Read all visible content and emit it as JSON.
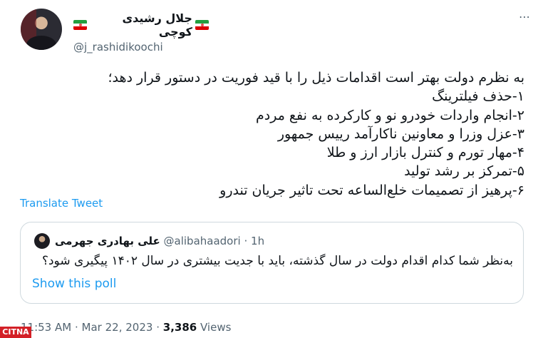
{
  "author": {
    "display_name": "جلال رشیدی کوچی",
    "handle": "@j_rashidikoochi"
  },
  "more_icon": "⋯",
  "tweet_lines": [
    "به نظرم دولت بهتر است اقدامات ذیل را با قید فوریت در دستور قرار دهد؛",
    "۱-حذف فیلترینگ",
    "۲-انجام واردات خودرو نو و کارکرده به نفع مردم",
    "۳-عزل وزرا و معاونین ناکارآمد رییس جمهور",
    "۴-مهار تورم و کنترل بازار ارز و طلا",
    "۵-تمرکز بر رشد تولید",
    "۶-پرهیز از تصمیمات خلع‌الساعه تحت تاثیر جریان تندرو"
  ],
  "translate_label": "Translate Tweet",
  "quote": {
    "name": "علی بهادری جهرمی",
    "handle": "@alibahaadori",
    "separator": "·",
    "time": "1h",
    "text": "به‌نظر شما کدام اقدام دولت در سال گذشته، باید با جدیت بیشتری در سال ۱۴۰۲ پیگیری شود؟",
    "poll_link": "Show this poll"
  },
  "footer": {
    "time": "11:53 AM",
    "sep1": "·",
    "date": "Mar 22, 2023",
    "sep2": "·",
    "views_count": "3,386",
    "views_label": "Views"
  },
  "watermark": "CITNA",
  "colors": {
    "link": "#1d9bf0",
    "muted": "#536471",
    "border": "#cfd9de"
  }
}
